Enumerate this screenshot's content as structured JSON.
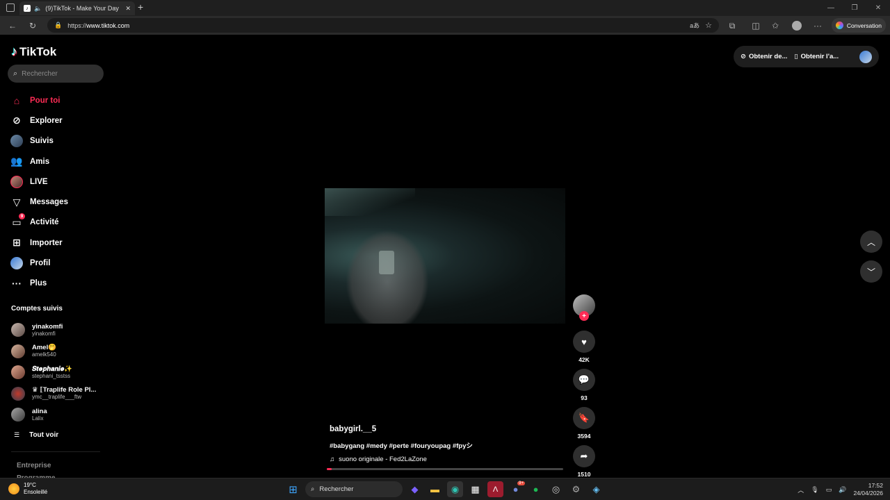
{
  "browser": {
    "tab_title": "(9)TikTok - Make Your Day",
    "new_tab": "+",
    "url_scheme": "https://",
    "url_host": "www.tiktok.com",
    "conversation_label": "Conversation"
  },
  "app": {
    "logo": "TikTok",
    "search_placeholder": "Rechercher"
  },
  "nav": [
    {
      "label": "Pour toi",
      "icon": "home-icon"
    },
    {
      "label": "Explorer",
      "icon": "compass-icon"
    },
    {
      "label": "Suivis",
      "icon": "avatar"
    },
    {
      "label": "Amis",
      "icon": "friends-icon"
    },
    {
      "label": "LIVE",
      "icon": "live-icon"
    },
    {
      "label": "Messages",
      "icon": "send-icon"
    },
    {
      "label": "Activité",
      "icon": "activity-icon",
      "badge": "9"
    },
    {
      "label": "Importer",
      "icon": "upload-icon"
    },
    {
      "label": "Profil",
      "icon": "avatar"
    },
    {
      "label": "Plus",
      "icon": "more-icon"
    }
  ],
  "following_title": "Comptes suivis",
  "following": [
    {
      "name": "yinakomfi",
      "user": "yinakomfi"
    },
    {
      "name": "Amel🤭",
      "user": "amelk540"
    },
    {
      "name": "𝑺𝒕𝒆𝒑𝒉𝒂𝒏𝒊𝒆✨",
      "user": "stephani_tsstss"
    },
    {
      "name": "♛ ⟦Traplife Role Pl...",
      "user": "ymc__traplife___ftw"
    },
    {
      "name": "alina",
      "user": "Lalix"
    }
  ],
  "see_all": "Tout voir",
  "footer_links": [
    "Entreprise",
    "Programme"
  ],
  "top_right": {
    "get_coins": "Obtenir de...",
    "get_app": "Obtenir l'a..."
  },
  "video": {
    "username": "babygirl.__5",
    "hashtags": "#babygang #medy #perte #fouryoupag #fpyシ",
    "music": "suono originale - Fed2LaZone",
    "progress": 0.02
  },
  "actions": {
    "likes": "42K",
    "comments": "93",
    "saves": "3594",
    "shares": "1510"
  },
  "taskbar": {
    "temperature": "19°C",
    "weather": "Ensoleillé",
    "search": "Rechercher",
    "time": "17:52",
    "date": "24/04/2026",
    "discord_badge": "9+"
  }
}
